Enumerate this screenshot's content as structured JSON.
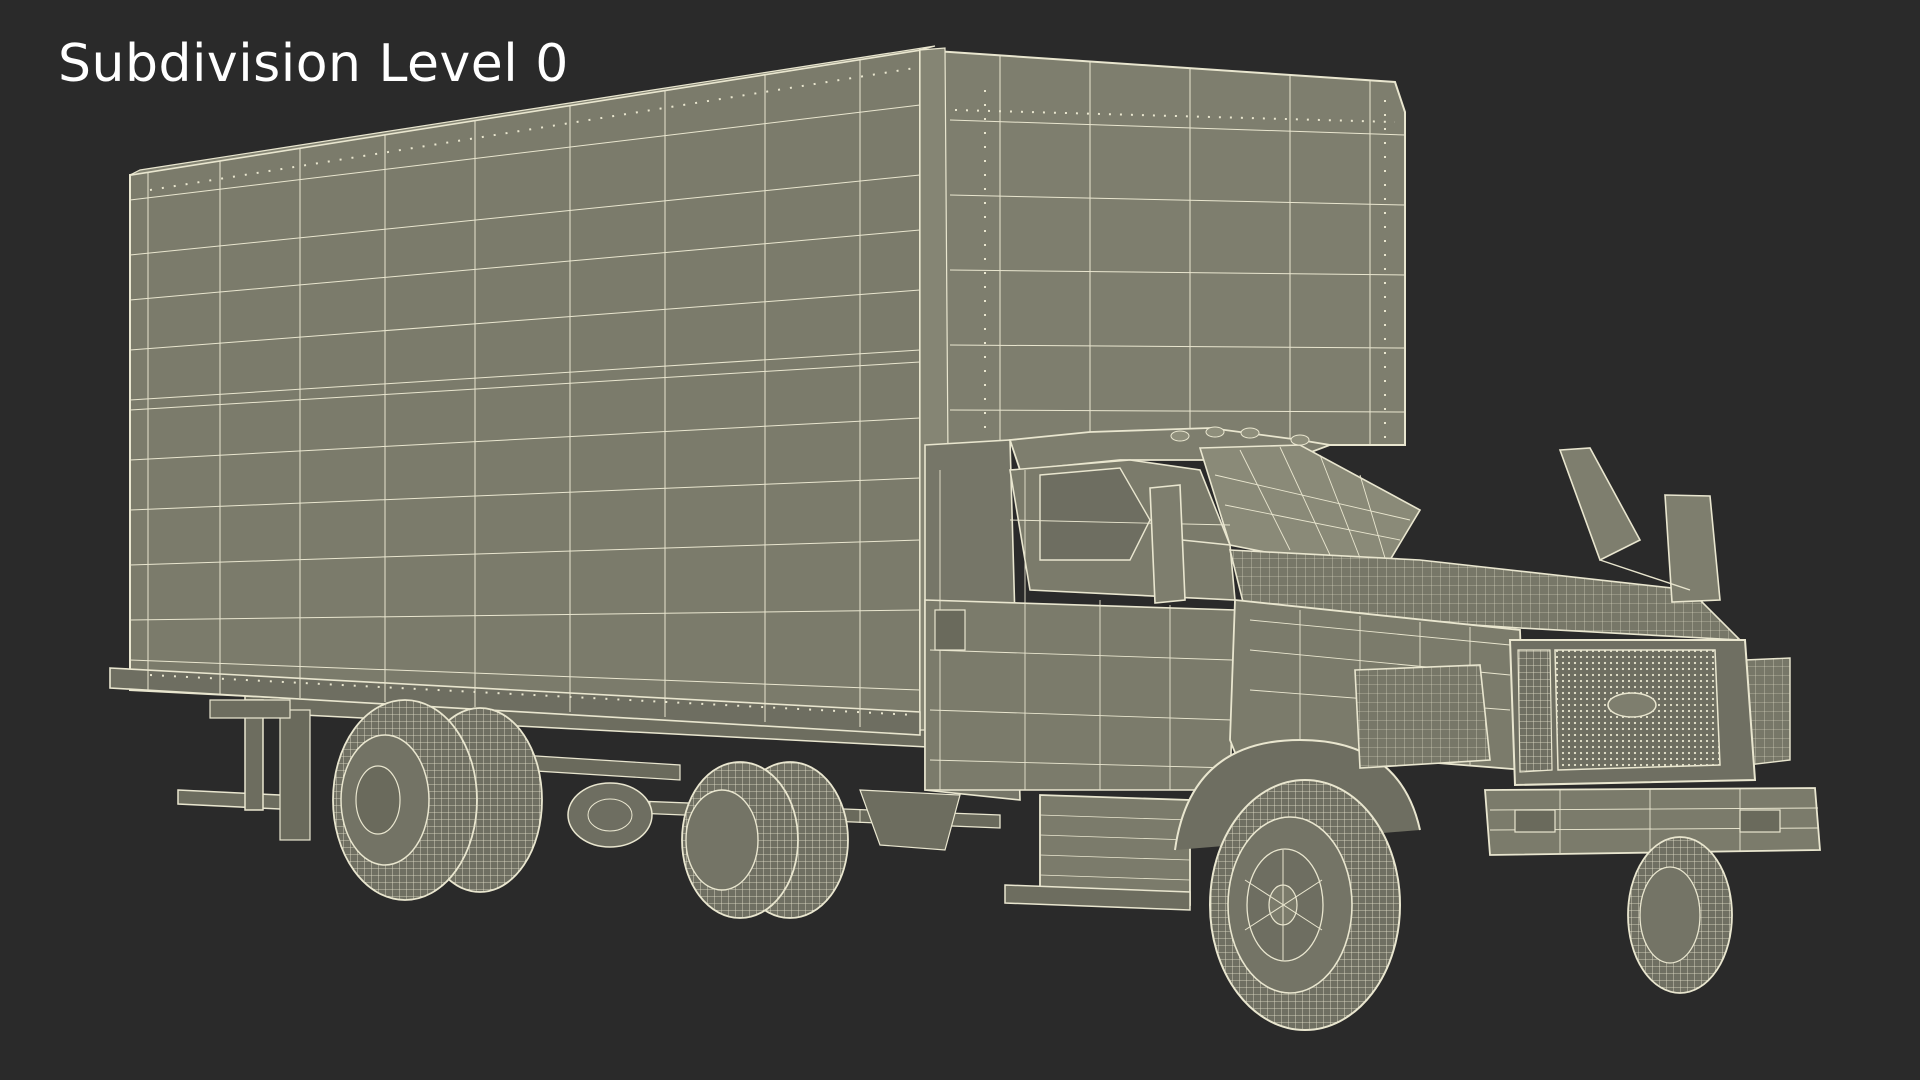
{
  "caption": {
    "text": "Subdivision Level 0"
  },
  "colors": {
    "background": "#2a2a2a",
    "surface": "#7b7b6b",
    "surface_dark": "#6a6a5c",
    "surface_light": "#858574",
    "wire": "#e9e6cf",
    "caption": "#ffffff"
  },
  "scene": {
    "subject": "box-truck-wireframe",
    "icon": "wireframe-truck-icon"
  }
}
